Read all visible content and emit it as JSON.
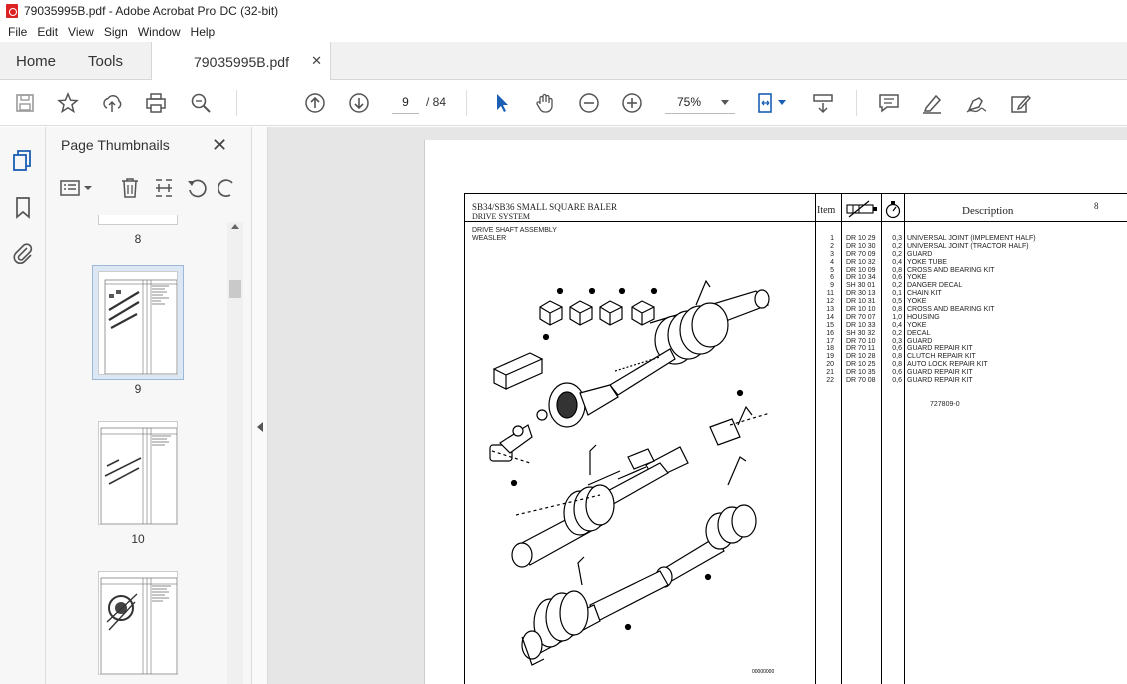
{
  "window": {
    "title": "79035995B.pdf - Adobe Acrobat Pro DC (32-bit)"
  },
  "menu": [
    "File",
    "Edit",
    "View",
    "Sign",
    "Window",
    "Help"
  ],
  "tabs": {
    "home": "Home",
    "tools": "Tools",
    "document": "79035995B.pdf"
  },
  "toolbar": {
    "page_current": "9",
    "page_total": "/ 84",
    "zoom": "75%"
  },
  "panel": {
    "title": "Page Thumbnails",
    "thumbs": [
      {
        "label": "8"
      },
      {
        "label": "9"
      },
      {
        "label": "10"
      }
    ]
  },
  "document": {
    "header_title": "SB34/SB36 SMALL SQUARE BALER",
    "header_subtitle": "DRIVE SYSTEM",
    "col_item": "Item",
    "col_description": "Description",
    "page_number": "8",
    "section_title": "DRIVE SHAFT ASSEMBLY",
    "section_subtitle": "WEASLER",
    "figure_ref": "727809-0",
    "figure_code": "00000000",
    "parts": [
      {
        "item": "1",
        "part": "DR 10 29",
        "qty": "0,3",
        "desc": "UNIVERSAL JOINT (IMPLEMENT HALF)"
      },
      {
        "item": "2",
        "part": "DR 10 30",
        "qty": "0,2",
        "desc": "UNIVERSAL JOINT (TRACTOR HALF)"
      },
      {
        "item": "3",
        "part": "DR 70 09",
        "qty": "0,2",
        "desc": "GUARD"
      },
      {
        "item": "4",
        "part": "DR 10 32",
        "qty": "0,4",
        "desc": "YOKE TUBE"
      },
      {
        "item": "5",
        "part": "DR 10 09",
        "qty": "0,8",
        "desc": "CROSS AND BEARING KIT"
      },
      {
        "item": "6",
        "part": "DR 10 34",
        "qty": "0,6",
        "desc": "YOKE"
      },
      {
        "item": "9",
        "part": "SH 30 01",
        "qty": "0,2",
        "desc": "DANGER DECAL"
      },
      {
        "item": "11",
        "part": "DR 30 13",
        "qty": "0,1",
        "desc": "CHAIN KIT"
      },
      {
        "item": "12",
        "part": "DR 10 31",
        "qty": "0,5",
        "desc": "YOKE"
      },
      {
        "item": "13",
        "part": "DR 10 10",
        "qty": "0,8",
        "desc": "CROSS AND BEARING KIT"
      },
      {
        "item": "14",
        "part": "DR 70 07",
        "qty": "1,0",
        "desc": "HOUSING"
      },
      {
        "item": "15",
        "part": "DR 10 33",
        "qty": "0,4",
        "desc": "YOKE"
      },
      {
        "item": "16",
        "part": "SH 30 32",
        "qty": "0,2",
        "desc": "DECAL"
      },
      {
        "item": "17",
        "part": "DR 70 10",
        "qty": "0,3",
        "desc": "GUARD"
      },
      {
        "item": "18",
        "part": "DR 70 11",
        "qty": "0,6",
        "desc": "GUARD REPAIR KIT"
      },
      {
        "item": "19",
        "part": "DR 10 28",
        "qty": "0,8",
        "desc": "CLUTCH REPAIR KIT"
      },
      {
        "item": "20",
        "part": "DR 10 25",
        "qty": "0,8",
        "desc": "AUTO LOCK REPAIR KIT"
      },
      {
        "item": "21",
        "part": "DR 10 35",
        "qty": "0,6",
        "desc": "GUARD REPAIR KIT"
      },
      {
        "item": "22",
        "part": "DR 70 08",
        "qty": "0,6",
        "desc": "GUARD REPAIR KIT"
      }
    ]
  }
}
